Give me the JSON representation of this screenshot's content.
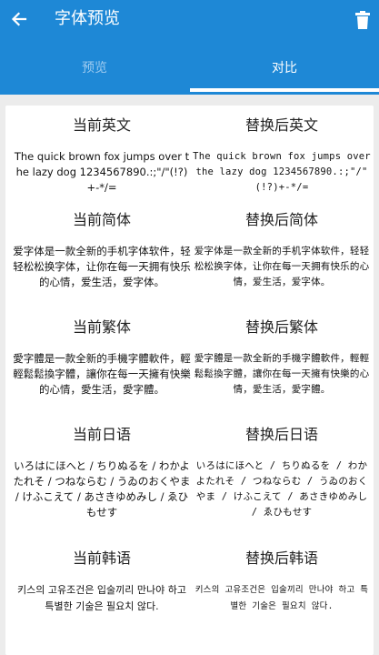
{
  "header": {
    "title": "字体预览"
  },
  "tabs": [
    {
      "label": "预览",
      "selected": false
    },
    {
      "label": "对比",
      "selected": true
    }
  ],
  "colors": {
    "primary": "#1e88d6",
    "tab_inactive": "#9ecbf0",
    "background": "#ececec"
  },
  "icons": {
    "back": "arrow-left-icon",
    "trash": "trash-icon"
  },
  "sections": [
    {
      "current_title": "当前英文",
      "replaced_title": "替换后英文",
      "current_text": "The quick brown fox jumps over the lazy dog 1234567890.:;\"/\"(!?)+-*/=",
      "replaced_text": "The quick brown fox jumps over the lazy dog 1234567890.:;\"/\"(!?)+-*/="
    },
    {
      "current_title": "当前简体",
      "replaced_title": "替换后简体",
      "current_text": "爱字体是一款全新的手机字体软件，轻轻松松换字体，让你在每一天拥有快乐的心情，爱生活，爱字体。",
      "replaced_text": "爱字体是一款全新的手机字体软件，轻轻松松换字体，让你在每一天拥有快乐的心情，爱生活，爱字体。"
    },
    {
      "current_title": "当前繁体",
      "replaced_title": "替换后繁体",
      "current_text": "愛字體是一款全新的手機字體軟件，輕輕鬆鬆換字體，讓你在每一天擁有快樂的心情，愛生活，愛字體。",
      "replaced_text": "愛字體是一款全新的手機字體軟件，輕輕鬆鬆換字體，讓你在每一天擁有快樂的心情，愛生活，愛字體。"
    },
    {
      "current_title": "当前日语",
      "replaced_title": "替换后日语",
      "current_text": "いろはにほへと / ちりぬるを / わかよたれそ / つねならむ / うゐのおくやま / けふこえて / あさきゆめみし / ゑひもせす",
      "replaced_text": "いろはにほへと / ちりぬるを / わかよたれそ / つねならむ / うゐのおくやま / けふこえて / あさきゆめみし / ゑひもせす"
    },
    {
      "current_title": "当前韩语",
      "replaced_title": "替换后韩语",
      "current_text": "키스의 고유조건은 입술끼리 만나야 하고 특별한 기술은 필요치 않다.",
      "replaced_text": "키스의 고유조건은 입술끼리 만나야 하고 특별한 기술은 필요치 않다."
    }
  ]
}
